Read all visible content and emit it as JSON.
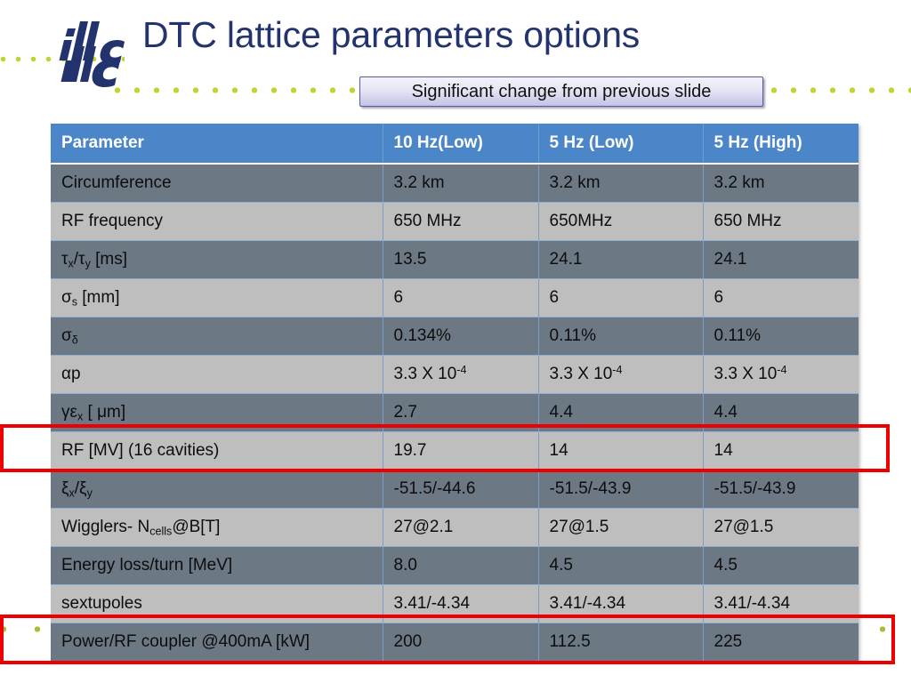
{
  "slide": {
    "title": "DTC lattice parameters options",
    "logo_alt": "ilc-logo",
    "callout": "Significant change from previous slide"
  },
  "table": {
    "columns": [
      "Parameter",
      "10  Hz(Low)",
      "5 Hz (Low)",
      "5 Hz (High)"
    ],
    "rows": [
      {
        "parameter": "Circumference",
        "plain": "Circumference",
        "v1": "3.2 km",
        "v2": "3.2 km",
        "v3": "3.2 km"
      },
      {
        "parameter": "RF frequency",
        "plain": "RF frequency",
        "v1": "650 MHz",
        "v2": "650MHz",
        "v3": "650 MHz"
      },
      {
        "parameter": "τx/τy [ms]",
        "plain": "tau_x/tau_y [ms]",
        "v1": "13.5",
        "v2": "24.1",
        "v3": "24.1"
      },
      {
        "parameter": "σs [mm]",
        "plain": "sigma_s [mm]",
        "v1": "6",
        "v2": "6",
        "v3": "6"
      },
      {
        "parameter": "σδ",
        "plain": "sigma_delta",
        "v1": "0.134%",
        "v2": "0.11%",
        "v3": "0.11%"
      },
      {
        "parameter": "αp",
        "plain": "alpha_p",
        "v1": "3.3 X 10-4",
        "v2": "3.3 X 10-4",
        "v3": "3.3 X 10-4"
      },
      {
        "parameter": "γεx [ μm]",
        "plain": "gamma*epsilon_x [ um]",
        "v1": "2.7",
        "v2": "4.4",
        "v3": "4.4"
      },
      {
        "parameter": "RF [MV] (16 cavities)",
        "plain": "RF [MV] (16 cavities)",
        "v1": "19.7",
        "v2": "14",
        "v3": "14"
      },
      {
        "parameter": "ξx/ξy",
        "plain": "xi_x/xi_y",
        "v1": "-51.5/-44.6",
        "v2": "-51.5/-43.9",
        "v3": "-51.5/-43.9"
      },
      {
        "parameter": "Wigglers-  Ncells@B[T]",
        "plain": "Wigglers- N_cells@B[T]",
        "v1": "27@2.1",
        "v2": "27@1.5",
        "v3": "27@1.5"
      },
      {
        "parameter": "Energy loss/turn [MeV]",
        "plain": "Energy loss/turn [MeV]",
        "v1": "8.0",
        "v2": "4.5",
        "v3": "4.5"
      },
      {
        "parameter": "sextupoles",
        "plain": "sextupoles",
        "v1": "3.41/-4.34",
        "v2": "3.41/-4.34",
        "v3": "3.41/-4.34"
      },
      {
        "parameter": "Power/RF coupler @400mA [kW]",
        "plain": "Power/RF coupler @400mA [kW]",
        "v1": "200",
        "v2": "112.5",
        "v3": "225"
      }
    ]
  },
  "highlights": [
    {
      "name": "highlight-rf-row",
      "target_row": "RF [MV] (16 cavities)"
    },
    {
      "name": "highlight-power-row",
      "target_row": "Power/RF coupler @400mA [kW]"
    }
  ],
  "colors": {
    "title": "#23336e",
    "header_blue": "#4a86c8",
    "row_dark": "#6d7885",
    "row_light": "#bdbebd",
    "highlight_red": "#ef0000",
    "dot_green": "#c3d22e",
    "logo_navy": "#23336e"
  }
}
